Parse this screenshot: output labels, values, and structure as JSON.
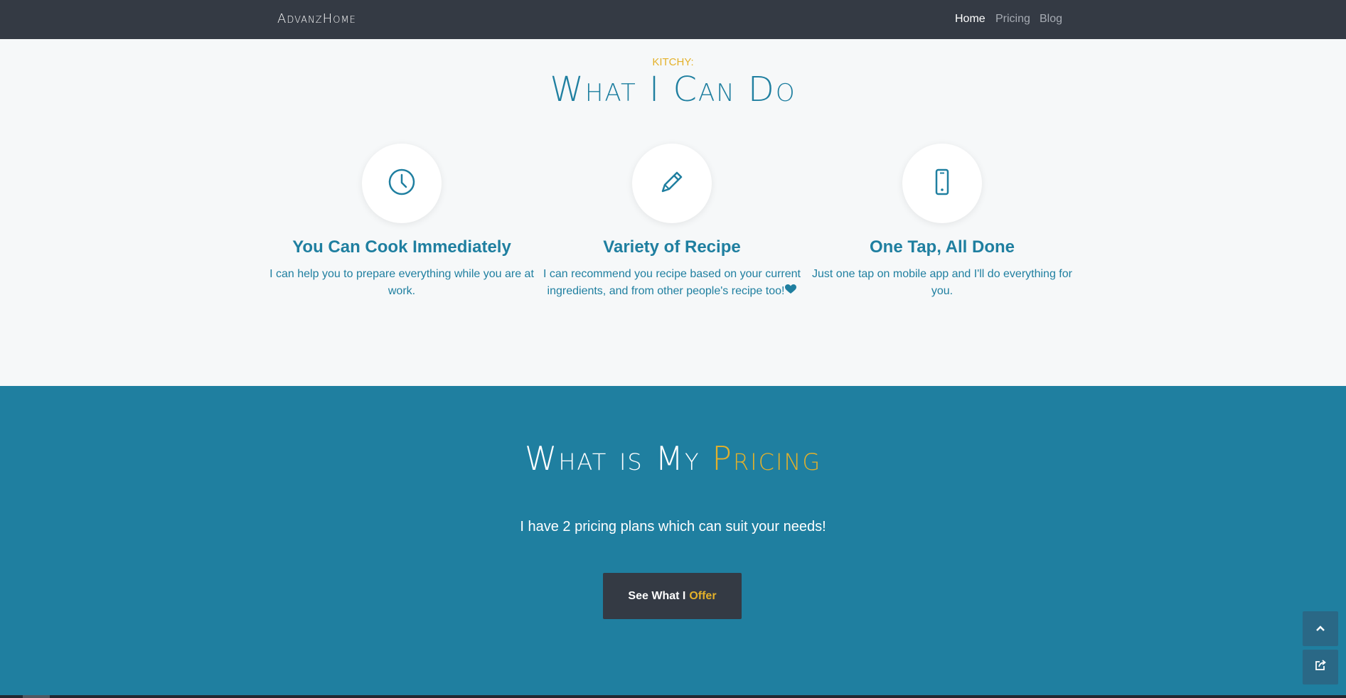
{
  "nav": {
    "brand": "AdvanzHome",
    "links": [
      "Home",
      "Pricing",
      "Blog"
    ]
  },
  "features_section": {
    "eyebrow": "KITCHY:",
    "title": "What I Can Do",
    "items": [
      {
        "icon": "clock-icon",
        "title": "You Can Cook Immediately",
        "text": "I can help you to prepare everything while you are at work."
      },
      {
        "icon": "pencil-icon",
        "title": "Variety of Recipe",
        "text": "I can recommend you recipe based on your current ingredients, and from other people's recipe too!"
      },
      {
        "icon": "mobile-phone-icon",
        "title": "One Tap, All Done",
        "text": "Just one tap on mobile app and I'll do everything for you."
      }
    ]
  },
  "pricing_section": {
    "title_main": "What is My",
    "title_accent": "Pricing",
    "subtitle": "I have 2 pricing plans which can suit your needs!",
    "cta_main": "See What I",
    "cta_accent": "Offer"
  },
  "floating_buttons": {
    "scroll_top_icon": "chevron-up-icon",
    "share_icon": "share-icon"
  },
  "colors": {
    "navbar": "#343a44",
    "primary": "#1f7fa0",
    "accent": "#e4b12a",
    "section_light": "#f6f8f9"
  }
}
